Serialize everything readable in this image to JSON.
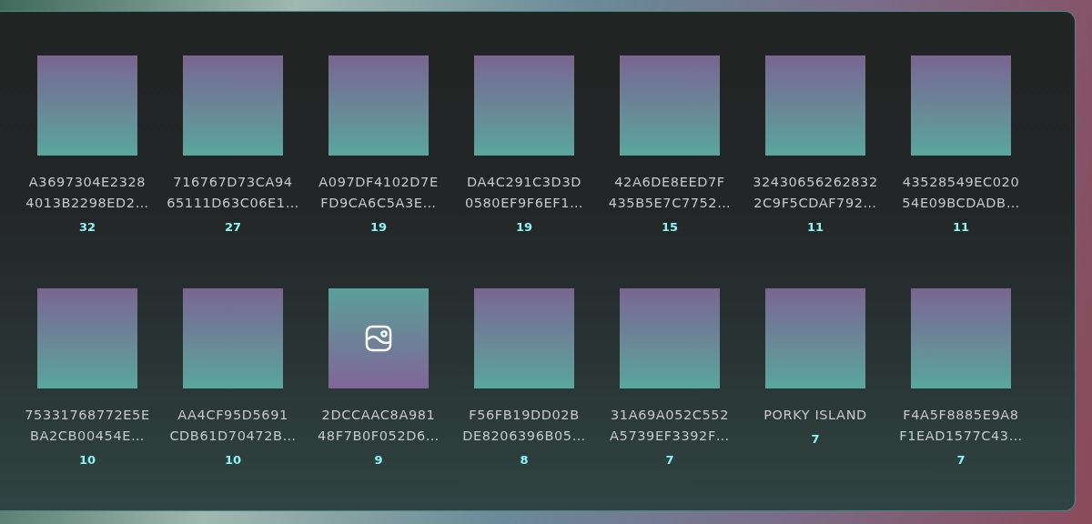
{
  "rows": [
    {
      "tiles": [
        {
          "name": "A3697304E2328 4013B2298ED2…",
          "count": "32",
          "hovered": false
        },
        {
          "name": "716767D73CA94 65111D63C06E1…",
          "count": "27",
          "hovered": false
        },
        {
          "name": "A097DF4102D7E FD9CA6C5A3E…",
          "count": "19",
          "hovered": false
        },
        {
          "name": "DA4C291C3D3D 0580EF9F6EF1…",
          "count": "19",
          "hovered": false
        },
        {
          "name": "42A6DE8EED7F 435B5E7C7752…",
          "count": "15",
          "hovered": false
        },
        {
          "name": "32430656262832 2C9F5CDAF792…",
          "count": "11",
          "hovered": false
        },
        {
          "name": "43528549EC020 54E09BCDADB…",
          "count": "11",
          "hovered": false
        }
      ]
    },
    {
      "tiles": [
        {
          "name": "75331768772E5E BA2CB00454E…",
          "count": "10",
          "hovered": false
        },
        {
          "name": "AA4CF95D5691 CDB61D70472B…",
          "count": "10",
          "hovered": false
        },
        {
          "name": "2DCCAAC8A981 48F7B0F052D6…",
          "count": "9",
          "hovered": true
        },
        {
          "name": "F56FB19DD02B DE8206396B05…",
          "count": "8",
          "hovered": false
        },
        {
          "name": "31A69A052C552 A5739EF3392F…",
          "count": "7",
          "hovered": false
        },
        {
          "name": "PORKY ISLAND",
          "count": "7",
          "hovered": false
        },
        {
          "name": "F4A5F8885E9A8 F1EAD1577C43…",
          "count": "7",
          "hovered": false
        }
      ]
    }
  ]
}
